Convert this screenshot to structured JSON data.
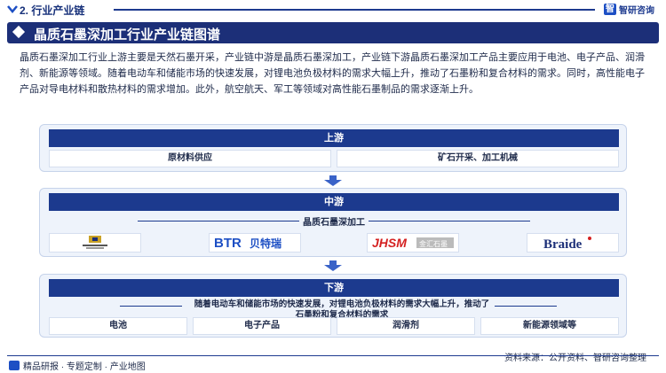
{
  "header": {
    "section_title": "2. 行业产业链",
    "logo_text": "智研咨询",
    "logo_mark": "智"
  },
  "title": "晶质石墨深加工行业产业链图谱",
  "intro": "晶质石墨深加工行业上游主要是天然石墨开采，产业链中游是晶质石墨深加工，产业链下游晶质石墨深加工产品主要应用于电池、电子产品、润滑剂、新能源等领域。随着电动车和储能市场的快速发展，对锂电池负极材料的需求大幅上升，推动了石墨粉和复合材料的需求。同时，高性能电子产品对导电材料和散热材料的需求增加。此外，航空航天、军工等领域对高性能石墨制品的需求逐渐上升。",
  "upstream": {
    "head": "上游",
    "items": [
      "原材料供应",
      "矿石开采、加工机械"
    ]
  },
  "midstream": {
    "head": "中游",
    "label": "晶质石墨深加工",
    "companies": [
      {
        "name": "联合石墨",
        "icon": "company-logo-1"
      },
      {
        "name": "BTR",
        "suffix": "贝特瑞"
      },
      {
        "name": "JHSM",
        "suffix": "金汇石墨"
      },
      {
        "name": "Braide"
      }
    ]
  },
  "downstream": {
    "head": "下游",
    "desc": "随着电动车和储能市场的快速发展，对锂电池负极材料的需求大幅上升，推动了石墨粉和复合材料的需求",
    "items": [
      "电池",
      "电子产品",
      "润滑剂",
      "新能源领域等"
    ]
  },
  "footer": {
    "left": "精品研报 · 专题定制 · 产业地图",
    "source": "资料来源：公开资料、智研咨询整理"
  },
  "colors": {
    "navy": "#1c2f78",
    "panel_bg": "#eef3fb",
    "accent_blue": "#1d4fc4",
    "jhsm_red": "#d42020"
  }
}
